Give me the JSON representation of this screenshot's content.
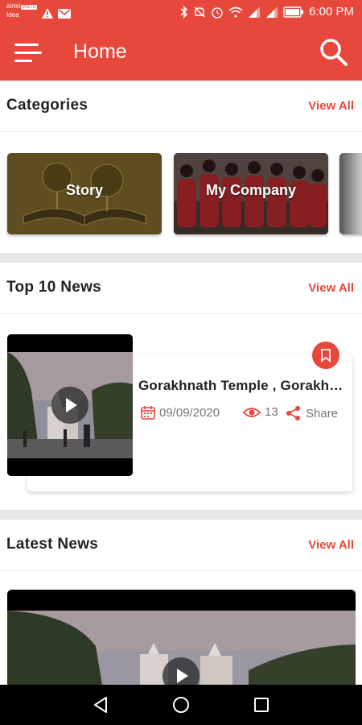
{
  "status_bar": {
    "carrier_line1": "airtel",
    "volte_badge": "VoLTE",
    "carrier_line2": "Idea",
    "time": "6:00 PM",
    "icons": [
      "alert-icon",
      "mail-icon",
      "bluetooth-icon",
      "mute-icon",
      "alarm-icon",
      "wifi-icon",
      "signal-icon",
      "signal-icon",
      "battery-icon"
    ]
  },
  "app_bar": {
    "title": "Home",
    "menu_icon": "menu-icon",
    "search_icon": "search-icon"
  },
  "categories": {
    "title": "Categories",
    "view_all": "View All",
    "items": [
      {
        "label": "Story"
      },
      {
        "label": "My Company"
      }
    ]
  },
  "top_news": {
    "title": "Top 10 News",
    "view_all": "View All",
    "items": [
      {
        "title": "Gorakhnath Temple , Gorakhpur",
        "date": "09/09/2020",
        "views": "13",
        "share": "Share"
      }
    ]
  },
  "latest_news": {
    "title": "Latest News",
    "view_all": "View All"
  },
  "colors": {
    "primary": "#e8473c",
    "text": "#222222",
    "meta": "#777777"
  }
}
